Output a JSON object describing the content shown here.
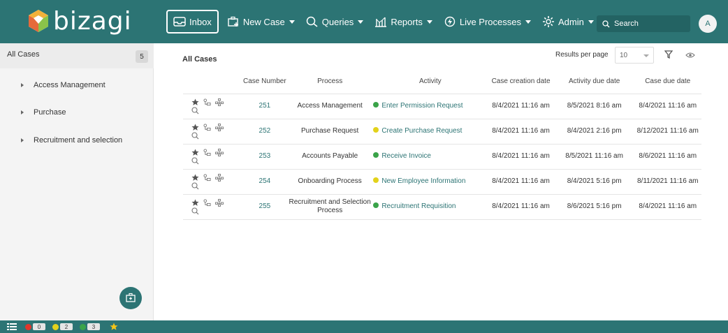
{
  "brand": {
    "name": "bizagi"
  },
  "nav": {
    "items": [
      {
        "label": "Inbox",
        "icon": "inbox-icon",
        "active": true
      },
      {
        "label": "New Case",
        "icon": "new-case-icon"
      },
      {
        "label": "Queries",
        "icon": "search-icon"
      },
      {
        "label": "Reports",
        "icon": "reports-icon"
      },
      {
        "label": "Live Processes",
        "icon": "live-processes-icon"
      },
      {
        "label": "Admin",
        "icon": "gear-icon"
      }
    ],
    "search_placeholder": "Search",
    "avatar_initial": "A"
  },
  "sidebar": {
    "title": "All Cases",
    "count": "5",
    "items": [
      {
        "label": "Access Management"
      },
      {
        "label": "Purchase"
      },
      {
        "label": "Recruitment and selection"
      }
    ]
  },
  "content": {
    "title": "All Cases",
    "results_per_page_label": "Results per page",
    "results_per_page_value": "10"
  },
  "table": {
    "headers": [
      "Case Number",
      "Process",
      "Activity",
      "Case creation date",
      "Activity due date",
      "Case due date"
    ],
    "rows": [
      {
        "case": "251",
        "process": "Access Management",
        "activity": "Enter Permission Request",
        "status_color": "#3aa349",
        "created": "8/4/2021 11:16 am",
        "activity_due": "8/5/2021 8:16 am",
        "case_due": "8/4/2021 11:16 am"
      },
      {
        "case": "252",
        "process": "Purchase Request",
        "activity": "Create Purchase Request",
        "status_color": "#e3d21b",
        "created": "8/4/2021 11:16 am",
        "activity_due": "8/4/2021 2:16 pm",
        "case_due": "8/12/2021 11:16 am"
      },
      {
        "case": "253",
        "process": "Accounts Payable",
        "activity": "Receive Invoice",
        "status_color": "#3aa349",
        "created": "8/4/2021 11:16 am",
        "activity_due": "8/5/2021 11:16 am",
        "case_due": "8/6/2021 11:16 am"
      },
      {
        "case": "254",
        "process": "Onboarding Process",
        "activity": "New Employee Information",
        "status_color": "#e3d21b",
        "created": "8/4/2021 11:16 am",
        "activity_due": "8/4/2021 5:16 pm",
        "case_due": "8/11/2021 11:16 am"
      },
      {
        "case": "255",
        "process": "Recruitment and Selection Process",
        "activity": "Recruitment Requisition",
        "status_color": "#3aa349",
        "created": "8/4/2021 11:16 am",
        "activity_due": "8/6/2021 5:16 pm",
        "case_due": "8/4/2021 11:16 am"
      }
    ]
  },
  "footer": {
    "red_count": "0",
    "yellow_count": "2",
    "green_count": "3"
  },
  "colors": {
    "brand": "#2c7474",
    "red": "#e0362b",
    "yellow": "#e3d21b",
    "green": "#3aa349",
    "star": "#f5c518"
  }
}
